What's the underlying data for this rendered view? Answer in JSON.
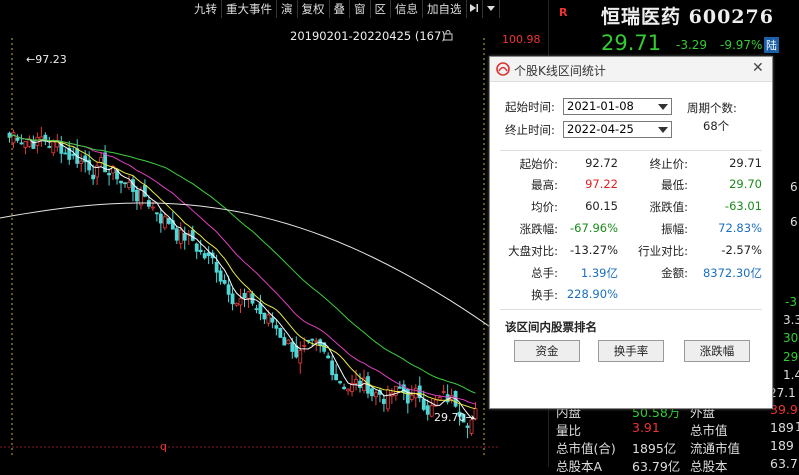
{
  "toolbar": {
    "items": [
      "九转",
      "重大事件",
      "演",
      "复权",
      "叠",
      "窗",
      "区",
      "信息",
      "加自选"
    ],
    "icons": [
      "skip-forward-icon",
      "dropdown-arrow-icon"
    ]
  },
  "chart": {
    "range_label": "20190201-20220425 (167)",
    "high_label": "97.23",
    "low_label": "29.70",
    "price_top": "100.98",
    "bottom_marker": "q",
    "colors": {
      "up": "#e33b3b",
      "down": "#4fd6d6",
      "ma5": "#ffffff",
      "ma10": "#e8e84a",
      "ma20": "#e040c0",
      "ma60": "#3ecf3e",
      "ma120": "#e6e6e6"
    }
  },
  "dialog": {
    "title": "个股K线区间统计",
    "start_label": "起始时间:",
    "start_value": "2021-01-08",
    "end_label": "终止时间:",
    "end_value": "2022-04-25",
    "period_label": "周期个数:",
    "period_value": "68个",
    "stats_left": [
      {
        "label": "起始价:",
        "value": "92.72",
        "color": "#222"
      },
      {
        "label": "最高:",
        "value": "97.22",
        "color": "#e02020"
      },
      {
        "label": "均价:",
        "value": "60.15",
        "color": "#222"
      },
      {
        "label": "涨跌幅:",
        "value": "-67.96%",
        "color": "#1a8a1a"
      },
      {
        "label": "大盘对比:",
        "value": "-13.27%",
        "color": "#222"
      },
      {
        "label": "总手:",
        "value": "1.39亿",
        "color": "#1a6fc0"
      },
      {
        "label": "换手:",
        "value": "228.90%",
        "color": "#1a6fc0"
      }
    ],
    "stats_right": [
      {
        "label": "终止价:",
        "value": "29.71",
        "color": "#222"
      },
      {
        "label": "最低:",
        "value": "29.70",
        "color": "#1a8a1a"
      },
      {
        "label": "涨跌值:",
        "value": "-63.01",
        "color": "#1a8a1a"
      },
      {
        "label": "振幅:",
        "value": "72.83%",
        "color": "#1a6fc0"
      },
      {
        "label": "行业对比:",
        "value": "-2.57%",
        "color": "#222"
      },
      {
        "label": "金额:",
        "value": "8372.30亿",
        "color": "#1a6fc0"
      }
    ],
    "rank_title": "该区间内股票排名",
    "rank_buttons": [
      "资金",
      "换手率",
      "涨跌幅"
    ]
  },
  "stock": {
    "badge": "R",
    "name": "恒瑞医药",
    "code": "600276",
    "price": "29.71",
    "change": "-3.29",
    "change_pct": "-9.97%",
    "board": "陆"
  },
  "edge_values": [
    {
      "text": "6",
      "color": "#ddd"
    },
    {
      "text": "6",
      "color": "#ddd"
    },
    {
      "text": "-3",
      "color": "#3c3"
    },
    {
      "text": "3.3",
      "color": "#ddd"
    },
    {
      "text": "30",
      "color": "#3c3"
    },
    {
      "text": "29",
      "color": "#3c3"
    },
    {
      "text": "1.4",
      "color": "#ddd"
    },
    {
      "text": "27.1",
      "color": "#ddd"
    },
    {
      "text": "1",
      "color": "#ddd"
    }
  ],
  "bottom": {
    "rows": [
      {
        "l1": "内盘",
        "v1": "50.58万",
        "l2": "外盘",
        "v2": "39.9",
        "c1": "#3c3",
        "c2": "#e33"
      },
      {
        "l1": "量比",
        "v1": "3.91",
        "l2": "总市值",
        "v2": "189",
        "c1": "#e33",
        "c2": "#ddd"
      },
      {
        "l1": "总市值(合)",
        "v1": "1895亿",
        "l2": "流通市值",
        "v2": "189",
        "c1": "#ddd",
        "c2": "#ddd"
      },
      {
        "l1": "总股本A",
        "v1": "63.79亿",
        "l2": "总股本",
        "v2": "63.7",
        "c1": "#ddd",
        "c2": "#ddd"
      }
    ]
  }
}
